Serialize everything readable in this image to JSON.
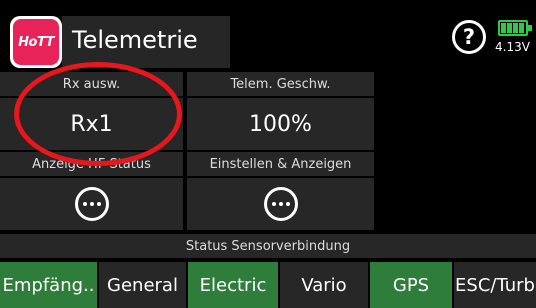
{
  "header": {
    "title": "Telemetrie",
    "logo_text": "HoTT",
    "help_symbol": "?",
    "battery": {
      "voltage": "4.13V",
      "color": "#2ecc40",
      "level": 1.0
    }
  },
  "cells": {
    "rx_select": {
      "label": "Rx ausw.",
      "value": "Rx1"
    },
    "telem_speed": {
      "label": "Telem. Geschw.",
      "value": "100%"
    },
    "hf_status": {
      "label": "Anzeige HF Status"
    },
    "settings_display": {
      "label": "Einstellen & Anzeigen"
    }
  },
  "status": {
    "label": "Status Sensorverbindung"
  },
  "tabs": [
    {
      "label": "Empfäng..",
      "active": false
    },
    {
      "label": "General",
      "active": false
    },
    {
      "label": "Electric",
      "active": false
    },
    {
      "label": "Vario",
      "active": false
    },
    {
      "label": "GPS",
      "active": true
    },
    {
      "label": "ESC/Turb",
      "active": false
    }
  ],
  "colors": {
    "accent_green": "#2f7d3a",
    "highlight_red": "#e8171e",
    "panel": "#272727",
    "logo_pink": "#e8235a"
  }
}
